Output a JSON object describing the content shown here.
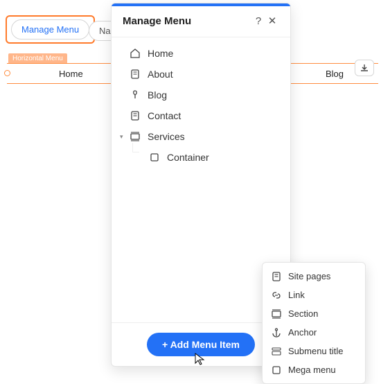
{
  "topButtons": {
    "manage": "Manage Menu",
    "navigate": "Na"
  },
  "canvas": {
    "badge": "Horizontal Menu",
    "items": {
      "home": "Home",
      "blog": "Blog"
    }
  },
  "panel": {
    "title": "Manage Menu",
    "items": [
      {
        "icon": "home-icon",
        "label": "Home"
      },
      {
        "icon": "page-icon",
        "label": "About"
      },
      {
        "icon": "pen-icon",
        "label": "Blog"
      },
      {
        "icon": "page-icon",
        "label": "Contact"
      },
      {
        "icon": "section-icon",
        "label": "Services",
        "expandable": true
      },
      {
        "icon": "square-icon",
        "label": "Container",
        "sub": true
      }
    ],
    "addButton": "+ Add Menu Item"
  },
  "context": {
    "items": [
      {
        "icon": "page-icon",
        "label": "Site pages"
      },
      {
        "icon": "link-icon",
        "label": "Link"
      },
      {
        "icon": "section-icon",
        "label": "Section"
      },
      {
        "icon": "anchor-icon",
        "label": "Anchor"
      },
      {
        "icon": "submenu-icon",
        "label": "Submenu title"
      },
      {
        "icon": "square-icon",
        "label": "Mega menu"
      }
    ]
  }
}
